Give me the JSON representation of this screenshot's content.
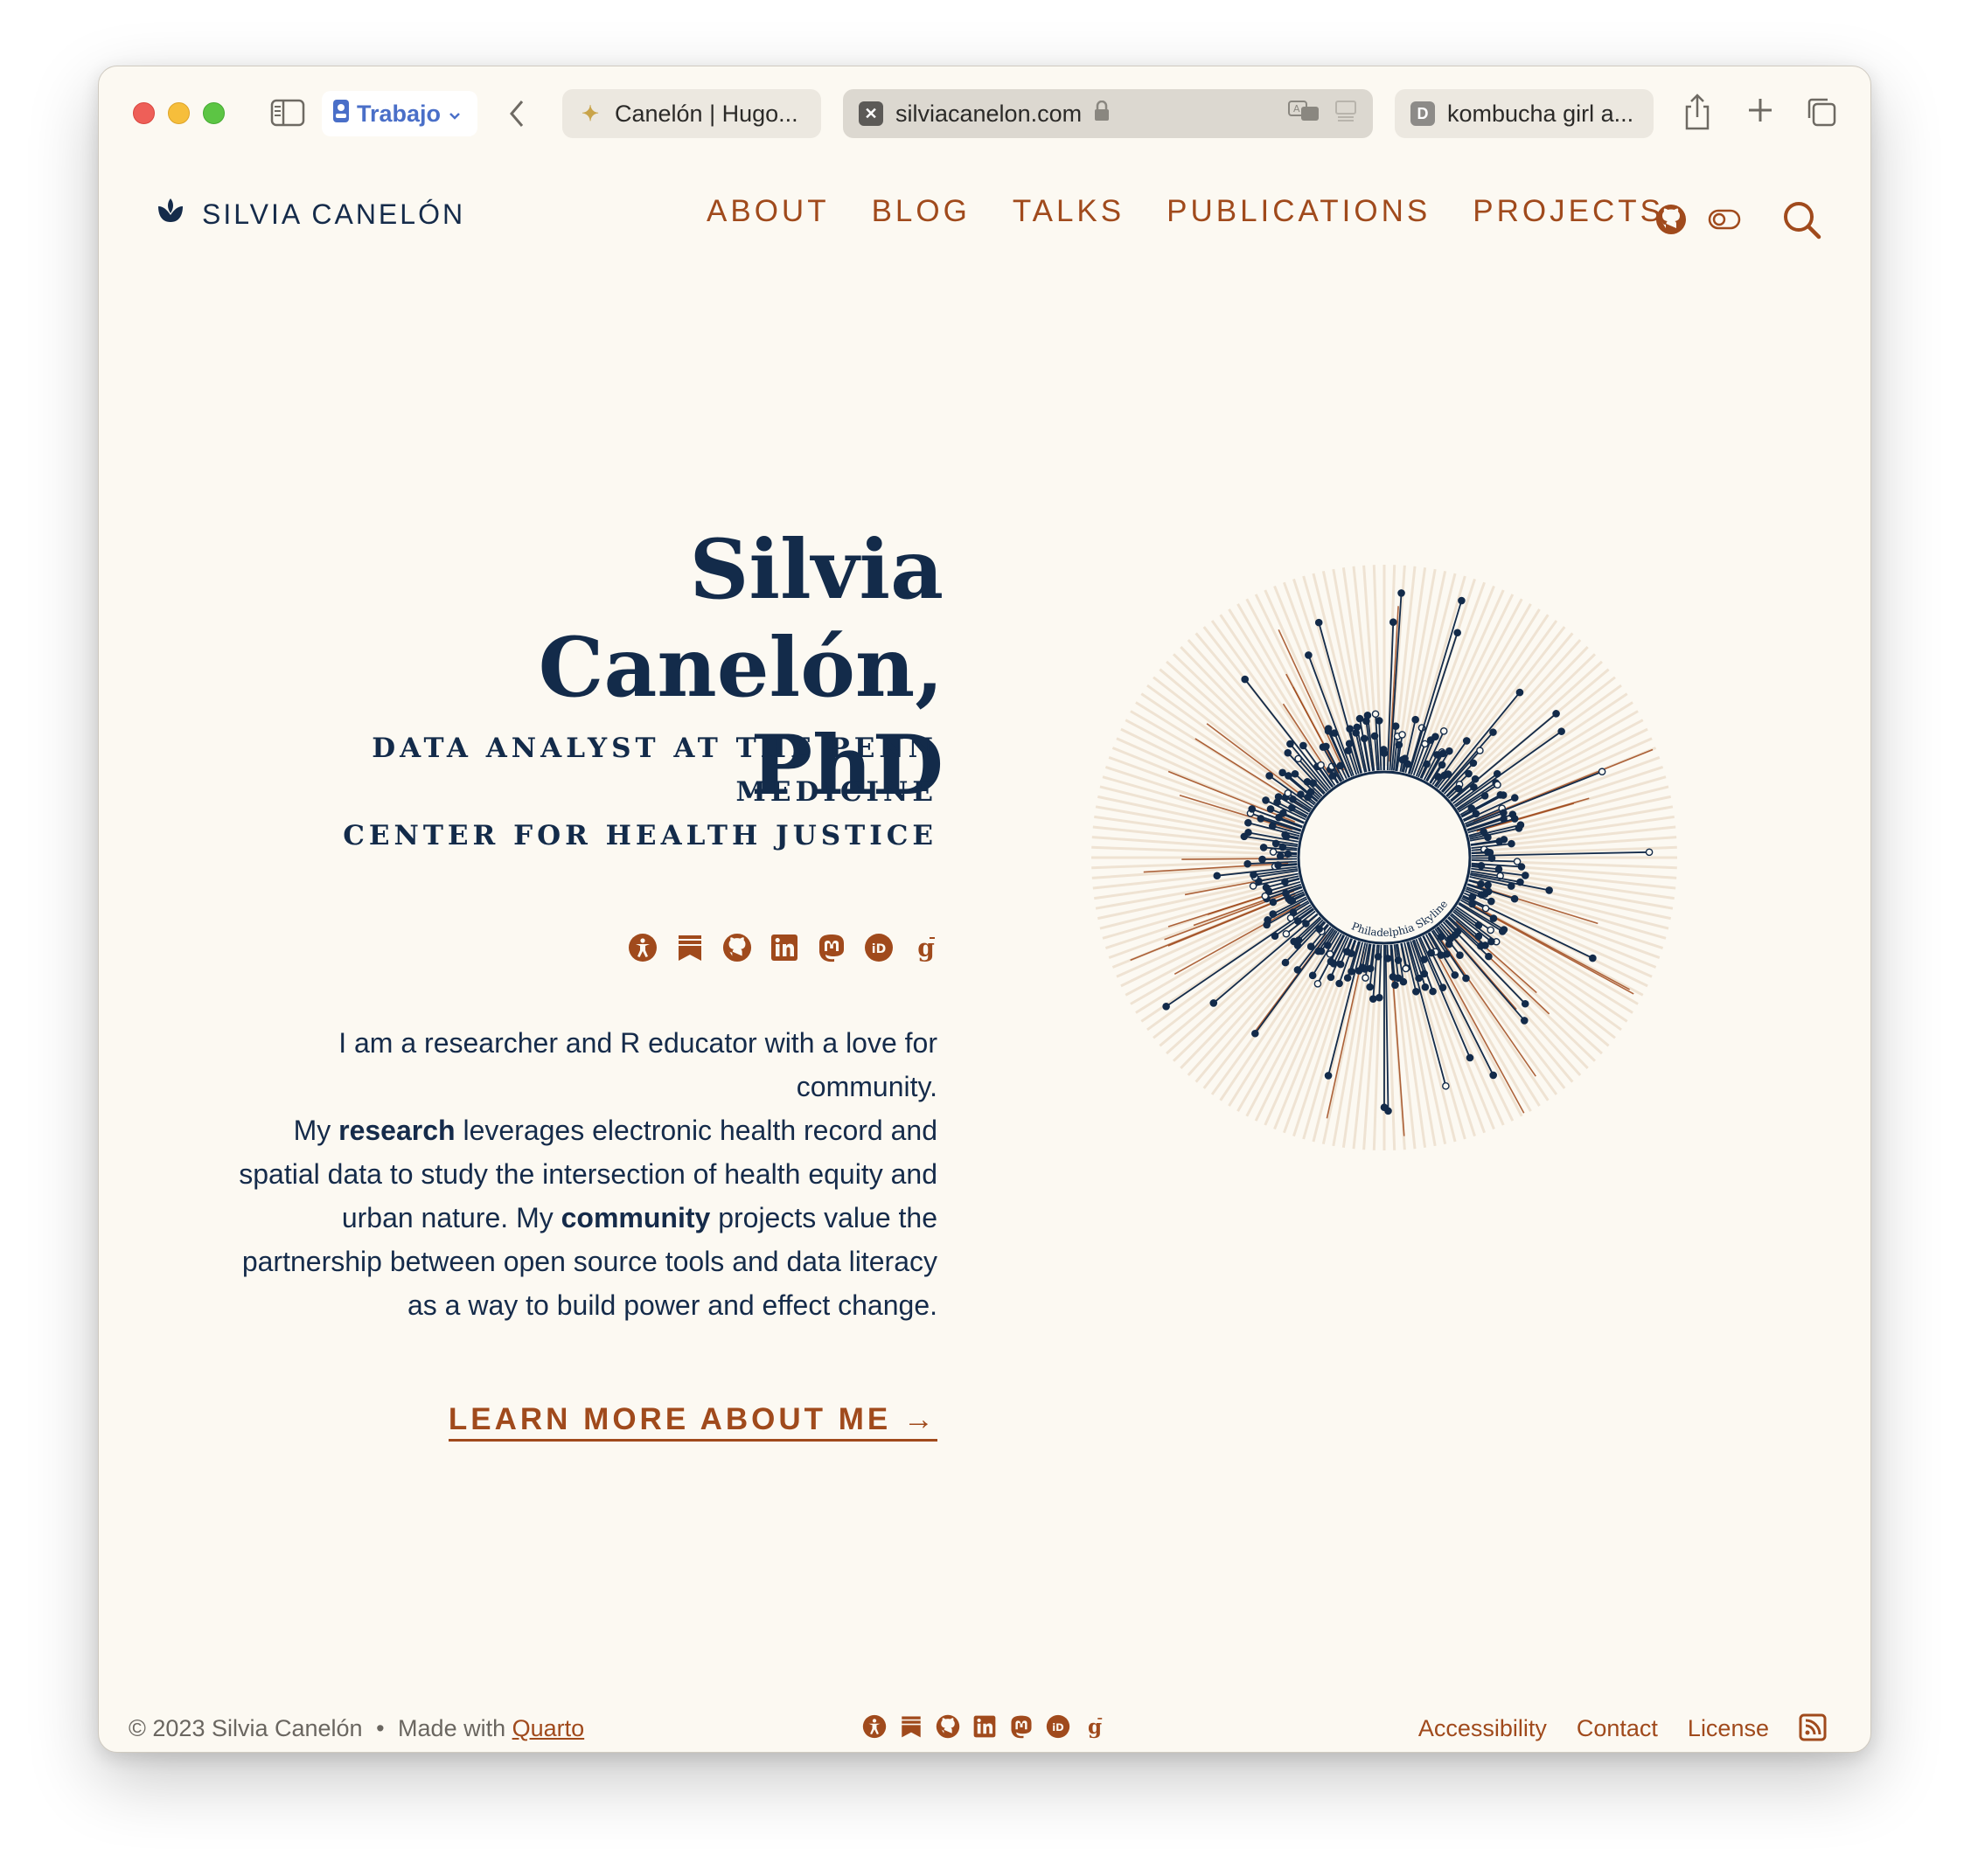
{
  "browser": {
    "profile_label": "Trabajo",
    "tabs": [
      {
        "title": "Canelón | Hugo..."
      },
      {
        "title": "silviacanelon.com",
        "active": true
      },
      {
        "title": "kombucha girl a...",
        "favicon_letter": "D"
      }
    ]
  },
  "site": {
    "brand": "SILVIA CANELÓN",
    "nav": [
      "ABOUT",
      "BLOG",
      "TALKS",
      "PUBLICATIONS",
      "PROJECTS"
    ]
  },
  "hero": {
    "title_line1": "Silvia Canelón,",
    "title_line2": "PhD",
    "subtitle_line1": "DATA ANALYST AT THE PENN MEDICINE",
    "subtitle_line2": "CENTER FOR HEALTH JUSTICE",
    "body_p1": "I am a researcher and R educator with a love for community.",
    "body_p2_a": "My ",
    "body_p2_b": "research",
    "body_p2_c": " leverages electronic health record and spatial data to study the intersection of health equity and urban nature. My ",
    "body_p2_d": "community",
    "body_p2_e": " projects value the partnership between open source tools and data literacy as a way to build power and effect change.",
    "learn_more": "LEARN MORE ABOUT ME →",
    "viz_label": "Philadelphia Skyline"
  },
  "socials": [
    "accessibility-icon",
    "bookmark-icon",
    "github-icon",
    "linkedin-icon",
    "mastodon-icon",
    "orcid-icon",
    "google-scholar-icon"
  ],
  "footer": {
    "copyright": "© 2023 Silvia Canelón",
    "separator": "•",
    "made_with": "Made with",
    "quarto": "Quarto",
    "links": [
      "Accessibility",
      "Contact",
      "License"
    ]
  },
  "colors": {
    "navy": "#132b4a",
    "rust": "#a04a1c",
    "background": "#fcf9f2"
  }
}
